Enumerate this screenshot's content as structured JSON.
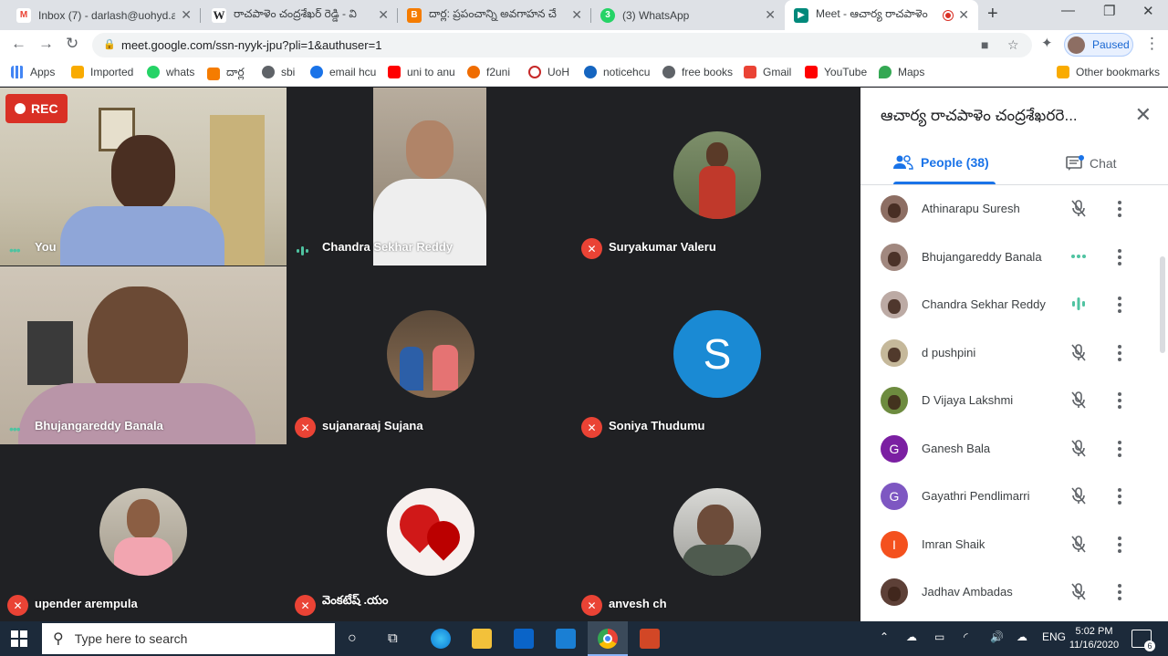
{
  "browser": {
    "tabs": [
      {
        "title": "Inbox (7) - darlash@uohyd.ac.i",
        "favicon": "gmail-icon"
      },
      {
        "title": "రాచపాళెం చంద్రశేఖర్ రెడ్డి - వి",
        "favicon": "wikipedia-icon"
      },
      {
        "title": "దార్ల: ప్రపంచాన్ని అవగాహన చే",
        "favicon": "blogger-icon"
      },
      {
        "title": "(3) WhatsApp",
        "favicon": "whatsapp-icon"
      },
      {
        "title": "Meet - ఆచార్య రాచపాళెం",
        "favicon": "meet-icon",
        "active": true
      }
    ],
    "url": "meet.google.com/ssn-nyyk-jpu?pli=1&authuser=1",
    "profile_status": "Paused",
    "bookmarks": [
      "Apps",
      "Imported",
      "whats",
      "దార్ల",
      "sbi",
      "email hcu",
      "uni to anu",
      "f2uni",
      "UoH",
      "noticehcu",
      "free books",
      "Gmail",
      "YouTube",
      "Maps"
    ],
    "other_bookmarks": "Other bookmarks"
  },
  "meet": {
    "rec_label": "REC",
    "tiles": [
      {
        "name": "You",
        "status": "dots"
      },
      {
        "name": "Chandra Sekhar Reddy",
        "status": "speaking"
      },
      {
        "name": "Suryakumar Valeru",
        "status": "muted"
      },
      {
        "name": "Bhujangareddy Banala",
        "status": "dots"
      },
      {
        "name": "sujanaraaj Sujana",
        "status": "muted"
      },
      {
        "name": "Soniya Thudumu",
        "status": "muted",
        "initial": "S"
      },
      {
        "name": "upender arempula",
        "status": "muted"
      },
      {
        "name": "వెంకటేష్ .యం",
        "status": "muted"
      },
      {
        "name": "anvesh ch",
        "status": "muted"
      }
    ]
  },
  "panel": {
    "title": "ఆచార్య రాచపాళెం చంద్రశేఖరరె...",
    "tab_people": "People (38)",
    "tab_chat": "Chat",
    "participants": [
      {
        "name": "Athinarapu Suresh",
        "status": "muted",
        "initial": "",
        "color": "#8d6e63"
      },
      {
        "name": "Bhujangareddy Banala",
        "status": "dots",
        "initial": "",
        "color": "#a1887f"
      },
      {
        "name": "Chandra Sekhar Reddy",
        "status": "speaking",
        "initial": "",
        "color": "#bcaaa4"
      },
      {
        "name": "d pushpini",
        "status": "muted",
        "initial": "",
        "color": "#c5b89a"
      },
      {
        "name": "D Vijaya Lakshmi",
        "status": "muted",
        "initial": "",
        "color": "#6d8b3f"
      },
      {
        "name": "Ganesh Bala",
        "status": "muted",
        "initial": "G",
        "color": "#7b1fa2"
      },
      {
        "name": "Gayathri Pendlimarri",
        "status": "muted",
        "initial": "G",
        "color": "#7e57c2"
      },
      {
        "name": "Imran Shaik",
        "status": "muted",
        "initial": "I",
        "color": "#f4511e"
      },
      {
        "name": "Jadhav Ambadas",
        "status": "muted",
        "initial": "",
        "color": "#5d4037"
      }
    ]
  },
  "taskbar": {
    "search_placeholder": "Type here to search",
    "lang": "ENG",
    "time": "5:02 PM",
    "date": "11/16/2020",
    "notifications": "6"
  }
}
